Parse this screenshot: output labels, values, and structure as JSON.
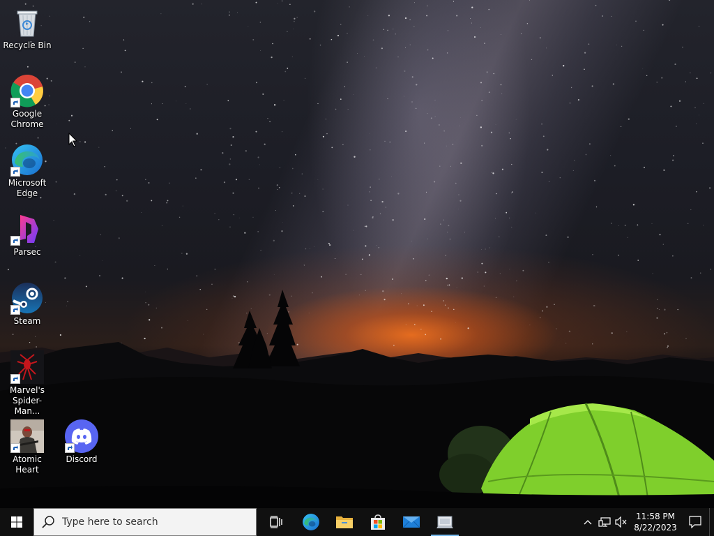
{
  "desktop": {
    "icons": [
      {
        "label": "Recycle Bin",
        "icon": "recycle-bin-icon"
      },
      {
        "label": "Google\nChrome",
        "icon": "chrome-icon"
      },
      {
        "label": "Microsoft\nEdge",
        "icon": "edge-icon"
      },
      {
        "label": "Parsec",
        "icon": "parsec-icon"
      },
      {
        "label": "Steam",
        "icon": "steam-icon"
      },
      {
        "label": "Marvel's\nSpider-Man...",
        "icon": "spider-man-icon"
      },
      {
        "label": "Atomic Heart",
        "icon": "atomic-heart-icon"
      },
      {
        "label": "Discord",
        "icon": "discord-icon"
      }
    ]
  },
  "taskbar": {
    "search_placeholder": "Type here to search",
    "pinned": [
      "task-view-icon",
      "edge-icon",
      "file-explorer-icon",
      "microsoft-store-icon",
      "mail-icon",
      "remote-app-icon"
    ],
    "tray": {
      "icons": [
        "chevron-up-icon",
        "network-icon",
        "volume-muted-icon"
      ],
      "time": "11:58 PM",
      "date": "8/22/2023"
    },
    "colors": {
      "background": "#101010",
      "active_indicator": "#76b9ed"
    }
  }
}
